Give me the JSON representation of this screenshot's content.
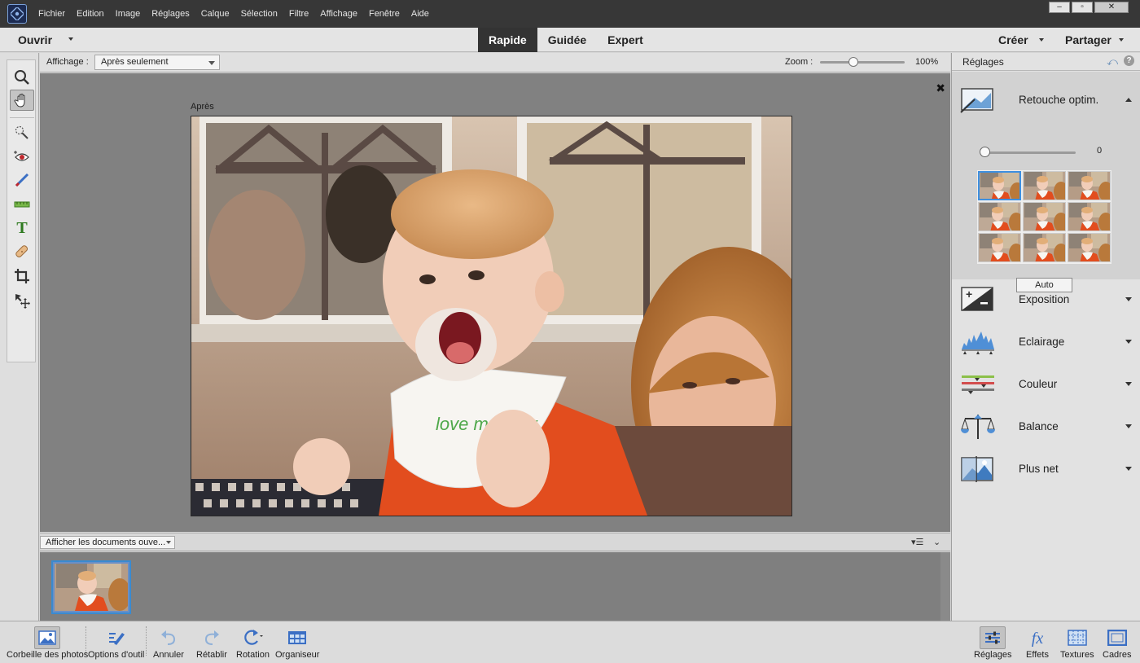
{
  "menu": [
    "Fichier",
    "Edition",
    "Image",
    "Réglages",
    "Calque",
    "Sélection",
    "Filtre",
    "Affichage",
    "Fenêtre",
    "Aide"
  ],
  "window_controls": [
    "–",
    "▫",
    "✕"
  ],
  "modebar": {
    "open_label": "Ouvrir",
    "tabs": [
      {
        "label": "Rapide",
        "active": true
      },
      {
        "label": "Guidée",
        "active": false
      },
      {
        "label": "Expert",
        "active": false
      }
    ],
    "create_label": "Créer",
    "share_label": "Partager"
  },
  "options": {
    "view_label": "Affichage :",
    "view_value": "Après seulement",
    "zoom_label": "Zoom :",
    "zoom_value": "100%",
    "zoom_fraction": 0.39
  },
  "canvas": {
    "image_label": "Après",
    "close_icon": "close-icon",
    "photo_text": "love mommy"
  },
  "bin": {
    "select_value": "Afficher les documents ouve...",
    "list_icon": "list-options-icon",
    "collapse_icon": "chevron-down-icon"
  },
  "panel": {
    "title": "Réglages",
    "smart_fix": {
      "label": "Retouche optim.",
      "amount": "0",
      "amount_fraction": 0.0,
      "auto_label": "Auto"
    },
    "adjustments": [
      {
        "label": "Exposition",
        "icon": "exposure-icon"
      },
      {
        "label": "Eclairage",
        "icon": "levels-histogram-icon"
      },
      {
        "label": "Couleur",
        "icon": "color-sliders-icon"
      },
      {
        "label": "Balance",
        "icon": "balance-scale-icon"
      },
      {
        "label": "Plus net",
        "icon": "sharpen-icon"
      }
    ]
  },
  "taskbar": {
    "left": [
      {
        "label": "Corbeille des photos",
        "icon": "photo-bin-icon",
        "active": true
      },
      {
        "label": "Options d'outil",
        "icon": "tool-options-icon",
        "active": false
      },
      {
        "label": "Annuler",
        "icon": "undo-icon",
        "active": false
      },
      {
        "label": "Rétablir",
        "icon": "redo-icon",
        "active": false
      },
      {
        "label": "Rotation",
        "icon": "rotate-icon",
        "active": false
      },
      {
        "label": "Organiseur",
        "icon": "organizer-icon",
        "active": false
      }
    ],
    "right": [
      {
        "label": "Réglages",
        "icon": "adjustments-icon",
        "active": true
      },
      {
        "label": "Effets",
        "icon": "effects-fx-icon",
        "active": false
      },
      {
        "label": "Textures",
        "icon": "textures-icon",
        "active": false
      },
      {
        "label": "Cadres",
        "icon": "frames-icon",
        "active": false
      }
    ]
  },
  "colors": {
    "accent": "#3d8fe0",
    "canvas_bg": "#818181",
    "titlebar": "#373737"
  }
}
